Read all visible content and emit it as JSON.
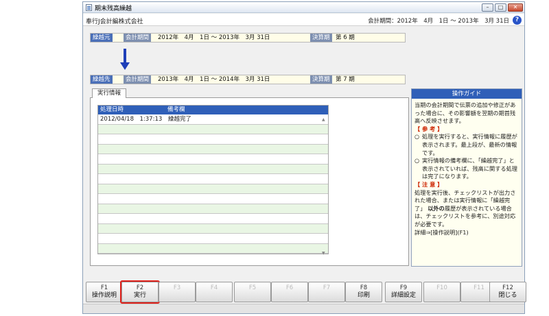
{
  "window": {
    "title": "期末残高繰越",
    "buttons": {
      "minimize": "–",
      "maximize": "□",
      "close": "✕"
    }
  },
  "infobar": {
    "company": "奉行J会計編株式会社",
    "period": "会計期間：2012年　4月　1日 ～ 2013年　3月 31日",
    "help": "?"
  },
  "source": {
    "tag": "繰越元",
    "period_label": "会計期間",
    "period": "2012年　4月　1日 ～ 2013年　3月 31日",
    "term_label": "決算期",
    "term": "第 6 期"
  },
  "dest": {
    "tag": "繰越先",
    "period_label": "会計期間",
    "period": "2013年　4月　1日 ～ 2014年　3月 31日",
    "term_label": "決算期",
    "term": "第 7 期"
  },
  "tab": {
    "label": "実行情報"
  },
  "grid": {
    "headers": [
      "処理日時",
      "備考欄"
    ],
    "rows": [
      [
        "2012/04/18　1:37:13",
        "繰越完了"
      ],
      [
        "",
        ""
      ],
      [
        "",
        ""
      ],
      [
        "",
        ""
      ],
      [
        "",
        ""
      ],
      [
        "",
        ""
      ],
      [
        "",
        ""
      ],
      [
        "",
        ""
      ],
      [
        "",
        ""
      ],
      [
        "",
        ""
      ],
      [
        "",
        ""
      ],
      [
        "",
        ""
      ],
      [
        "",
        ""
      ],
      [
        "",
        ""
      ]
    ],
    "scroll_up": "▲",
    "scroll_down": "▼"
  },
  "guide": {
    "title": "操作ガイド",
    "intro": "当期の会計期間で伝票の追加や修正があった場合に、その影響額を翌期の期首残高へ反映させます。",
    "ref_heading": "【 参 考 】",
    "ref_items": [
      "処理を実行すると、実行情報に履歴が表示されます。最上段が、最新の情報です。",
      "実行情報の備考欄に、「繰越完了」と表示されていれば、残高に関する処理は完了になります。"
    ],
    "bullet_mark": "○",
    "note_heading": "【 注 意 】",
    "note_a": "処理を実行後、チェックリストが出力された場合、または実行情報に「繰越完了」",
    "note_bold": " 以外の",
    "note_b": "履歴が表示されている場合は、チェックリストを参考に、別途対応が必要です。",
    "details": "詳細⇒[操作説明](F1)"
  },
  "fkeys": [
    {
      "key": "F1",
      "label": "操作説明"
    },
    {
      "key": "F2",
      "label": "実行"
    },
    {
      "key": "F3",
      "label": ""
    },
    {
      "key": "F4",
      "label": ""
    },
    {
      "key": "F5",
      "label": ""
    },
    {
      "key": "F6",
      "label": ""
    },
    {
      "key": "F7",
      "label": ""
    },
    {
      "key": "F8",
      "label": "印刷"
    },
    {
      "key": "F9",
      "label": "詳細設定"
    },
    {
      "key": "F10",
      "label": ""
    },
    {
      "key": "F11",
      "label": ""
    },
    {
      "key": "F12",
      "label": "閉じる"
    }
  ],
  "colors": {
    "accent": "#2f5fb8",
    "highlight": "#e0201a",
    "row_alt": "#e9f6e4",
    "field_bg": "#fffde8"
  }
}
